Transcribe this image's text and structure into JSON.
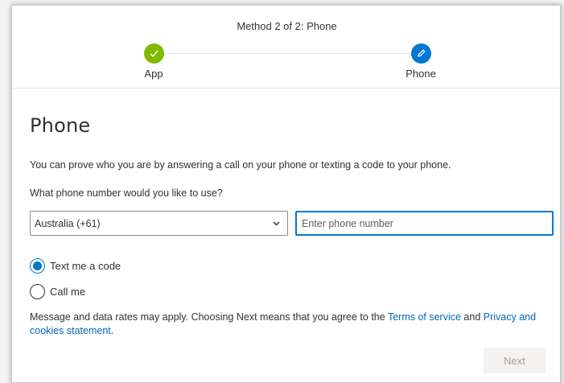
{
  "header": {
    "method_title": "Method 2 of 2: Phone",
    "steps": [
      {
        "label": "App",
        "state": "complete",
        "color": "#7fba00"
      },
      {
        "label": "Phone",
        "state": "current",
        "color": "#0078d4"
      }
    ]
  },
  "main": {
    "title": "Phone",
    "description": "You can prove who you are by answering a call on your phone or texting a code to your phone.",
    "question": "What phone number would you like to use?",
    "country_select": {
      "value": "Australia (+61)"
    },
    "phone_input": {
      "value": "",
      "placeholder": "Enter phone number"
    },
    "radios": [
      {
        "label": "Text me a code",
        "checked": true
      },
      {
        "label": "Call me",
        "checked": false
      }
    ],
    "legal": {
      "prefix": "Message and data rates may apply. Choosing Next means that you agree to the ",
      "terms_link": "Terms of service",
      "and": " and ",
      "privacy_link": "Privacy and cookies statement",
      "suffix": "."
    },
    "next_label": "Next"
  },
  "colors": {
    "accent": "#0078d4",
    "success": "#7fba00",
    "link": "#0067b8"
  }
}
